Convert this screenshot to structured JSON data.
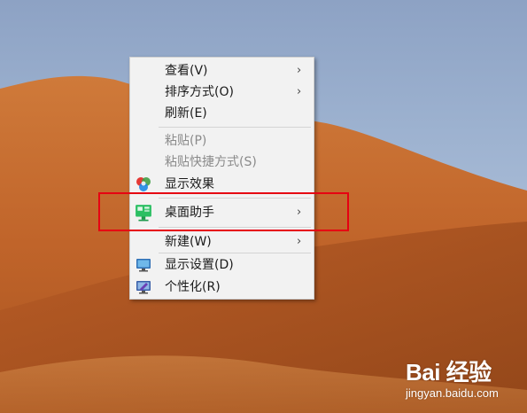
{
  "context_menu": {
    "items": [
      {
        "label": "查看(V)",
        "submenu": true,
        "enabled": true,
        "icon": "none"
      },
      {
        "label": "排序方式(O)",
        "submenu": true,
        "enabled": true,
        "icon": "none"
      },
      {
        "label": "刷新(E)",
        "submenu": false,
        "enabled": true,
        "icon": "none"
      },
      {
        "label": "粘贴(P)",
        "submenu": false,
        "enabled": false,
        "icon": "none"
      },
      {
        "label": "粘贴快捷方式(S)",
        "submenu": false,
        "enabled": false,
        "icon": "none"
      },
      {
        "label": "显示效果",
        "submenu": false,
        "enabled": true,
        "icon": "color-balls-icon"
      },
      {
        "label": "桌面助手",
        "submenu": true,
        "enabled": true,
        "icon": "desktop-assistant-icon"
      },
      {
        "label": "新建(W)",
        "submenu": true,
        "enabled": true,
        "icon": "none"
      },
      {
        "label": "显示设置(D)",
        "submenu": false,
        "enabled": true,
        "icon": "display-settings-icon"
      },
      {
        "label": "个性化(R)",
        "submenu": false,
        "enabled": true,
        "icon": "personalize-icon"
      }
    ],
    "submenu_arrow": "›"
  },
  "highlight_box": {
    "color": "#e60012",
    "target": "桌面助手"
  },
  "watermark": {
    "logo": "Bai 经验",
    "url": "jingyan.baidu.com"
  },
  "colors": {
    "sky": "#a9bcd7",
    "dune": "#c4682a",
    "menu_bg": "#f2f2f2"
  }
}
